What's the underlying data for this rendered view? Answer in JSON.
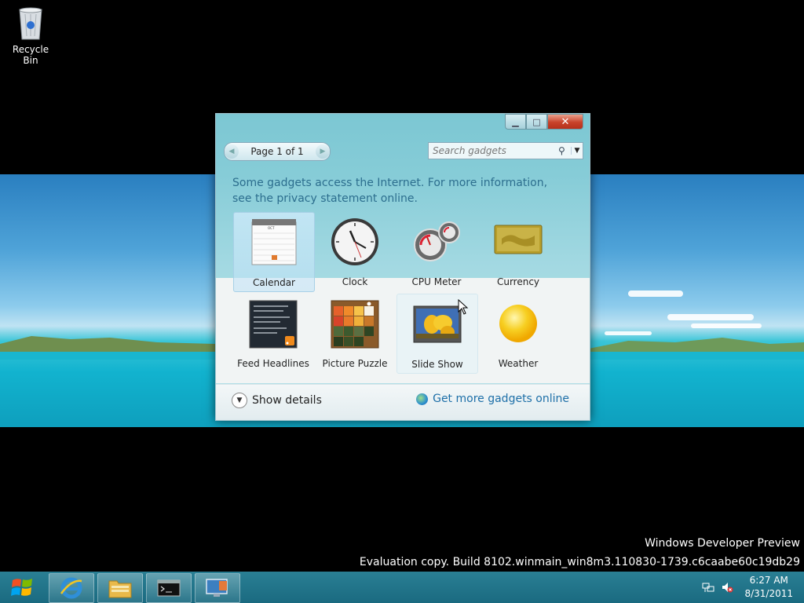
{
  "desktop": {
    "recycle_bin_label": "Recycle Bin"
  },
  "watermark": {
    "line1": "Windows Developer Preview",
    "line2": "Evaluation copy. Build 8102.winmain_win8m3.110830-1739.c6caabe60c19db29"
  },
  "gadget_window": {
    "pager_label": "Page 1 of 1",
    "search_placeholder": "Search gadgets",
    "notice_text": "Some gadgets access the Internet.  For more information, see the privacy statement online.",
    "gadgets": [
      {
        "label": "Calendar",
        "icon": "calendar-icon"
      },
      {
        "label": "Clock",
        "icon": "clock-icon"
      },
      {
        "label": "CPU Meter",
        "icon": "cpu-meter-icon"
      },
      {
        "label": "Currency",
        "icon": "currency-icon"
      },
      {
        "label": "Feed Headlines",
        "icon": "feed-headlines-icon"
      },
      {
        "label": "Picture Puzzle",
        "icon": "picture-puzzle-icon"
      },
      {
        "label": "Slide Show",
        "icon": "slide-show-icon"
      },
      {
        "label": "Weather",
        "icon": "weather-icon"
      }
    ],
    "calendar_month": "OCT 06",
    "show_details_label": "Show details",
    "get_more_label": "Get more gadgets online"
  },
  "taskbar": {
    "time": "6:27 AM",
    "date": "8/31/2011"
  },
  "colors": {
    "taskbar": "#1f7389",
    "close_button": "#c8422a",
    "link": "#1d6fa8",
    "notice_text": "#2c6e8e"
  }
}
